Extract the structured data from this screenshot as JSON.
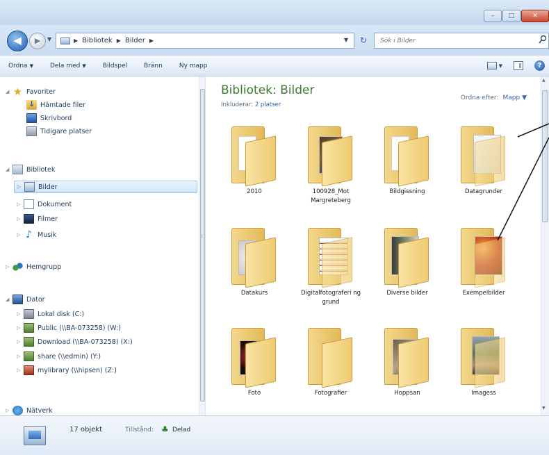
{
  "window": {
    "min": "–",
    "max": "□",
    "close": "✕"
  },
  "address": {
    "breadcrumbs": [
      "Bibliotek",
      "Bilder"
    ],
    "search_placeholder": "Sök i Bilder"
  },
  "toolbar": {
    "items": [
      "Ordna",
      "Dela med",
      "Bildspel",
      "Bränn",
      "Ny mapp"
    ]
  },
  "nav": {
    "favorites": "Favoriter",
    "downloads": "Hämtade filer",
    "desktop": "Skrivbord",
    "recent": "Tidigare platser",
    "libraries": "Bibliotek",
    "pictures": "Bilder",
    "documents": "Dokument",
    "videos": "Filmer",
    "music": "Musik",
    "homegroup": "Hemgrupp",
    "computer": "Dator",
    "local_disk": "Lokal disk (C:)",
    "public": "Public (\\\\BA-073258) (W:)",
    "download": "Download (\\\\BA-073258) (X:)",
    "share": "share (\\\\edmin) (Y:)",
    "mylibrary": "mylibrary (\\\\hipsen) (Z:)",
    "network": "Nätverk"
  },
  "content": {
    "title": "Bibliotek: Bilder",
    "includes_label": "Inkluderar:",
    "includes_link": "2 platser",
    "arrange_label": "Ordna efter:",
    "arrange_value": "Mapp",
    "folders": [
      "2010",
      "100928_Mot Margreteberg",
      "Bildgissning",
      "Datagrunder",
      "Datakurs",
      "Digitalfotograferi ng grund",
      "Diverse bilder",
      "Exempelbilder",
      "Foto",
      "Fotografier",
      "Hoppsan",
      "Imagess"
    ]
  },
  "details": {
    "count": "17 objekt",
    "state_label": "Tillstånd:",
    "state_value": "Delad"
  }
}
